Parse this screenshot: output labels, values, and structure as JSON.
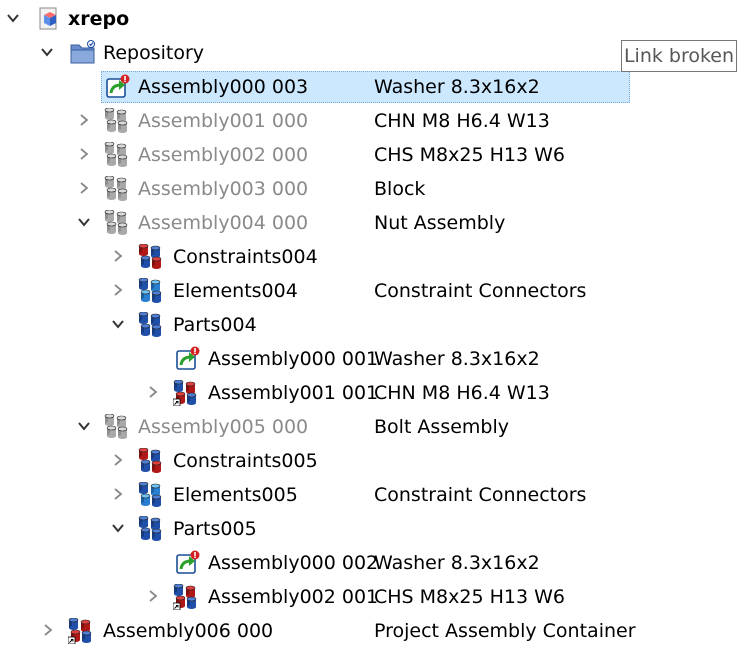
{
  "tooltip": {
    "text": "Link broken"
  },
  "tree": [
    {
      "name": "xrepo",
      "desc": "",
      "expander": "expanded",
      "icon": "cube-document-icon",
      "style": "bold"
    },
    {
      "name": "Repository",
      "desc": "",
      "expander": "expanded",
      "icon": "folder-icon",
      "style": "normal"
    },
    {
      "name": "Assembly000 003",
      "desc": "Washer 8.3x16x2",
      "expander": "none",
      "icon": "broken-link-icon",
      "style": "normal",
      "selected": true
    },
    {
      "name": "Assembly001 000",
      "desc": "CHN M8 H6.4 W13",
      "expander": "collapsed",
      "icon": "assembly-grey-icon",
      "style": "grey"
    },
    {
      "name": "Assembly002 000",
      "desc": "CHS M8x25 H13 W6",
      "expander": "collapsed",
      "icon": "assembly-grey-icon",
      "style": "grey"
    },
    {
      "name": "Assembly003 000",
      "desc": "Block",
      "expander": "collapsed",
      "icon": "assembly-grey-icon",
      "style": "grey"
    },
    {
      "name": "Assembly004 000",
      "desc": "Nut Assembly",
      "expander": "expanded",
      "icon": "assembly-grey-icon",
      "style": "grey"
    },
    {
      "name": "Constraints004",
      "desc": "",
      "expander": "collapsed",
      "icon": "constraints-icon",
      "style": "normal"
    },
    {
      "name": "Elements004",
      "desc": "Constraint Connectors",
      "expander": "collapsed",
      "icon": "elements-icon",
      "style": "normal"
    },
    {
      "name": "Parts004",
      "desc": "",
      "expander": "expanded",
      "icon": "parts-icon",
      "style": "normal"
    },
    {
      "name": "Assembly000 001",
      "desc": "Washer 8.3x16x2",
      "expander": "none",
      "icon": "broken-link-icon",
      "style": "normal"
    },
    {
      "name": "Assembly001 001",
      "desc": "CHN M8 H6.4 W13",
      "expander": "collapsed",
      "icon": "assembly-link-icon",
      "style": "normal"
    },
    {
      "name": "Assembly005 000",
      "desc": "Bolt Assembly",
      "expander": "expanded",
      "icon": "assembly-grey-icon",
      "style": "grey"
    },
    {
      "name": "Constraints005",
      "desc": "",
      "expander": "collapsed",
      "icon": "constraints-icon",
      "style": "normal"
    },
    {
      "name": "Elements005",
      "desc": "Constraint Connectors",
      "expander": "collapsed",
      "icon": "elements-icon",
      "style": "normal"
    },
    {
      "name": "Parts005",
      "desc": "",
      "expander": "expanded",
      "icon": "parts-icon",
      "style": "normal"
    },
    {
      "name": "Assembly000 002",
      "desc": "Washer 8.3x16x2",
      "expander": "none",
      "icon": "broken-link-icon",
      "style": "normal"
    },
    {
      "name": "Assembly002 001",
      "desc": "CHS M8x25 H13 W6",
      "expander": "collapsed",
      "icon": "assembly-link-icon",
      "style": "normal"
    },
    {
      "name": "Assembly006 000",
      "desc": "Project Assembly Container",
      "expander": "collapsed",
      "icon": "assembly-link-icon",
      "style": "normal"
    }
  ]
}
